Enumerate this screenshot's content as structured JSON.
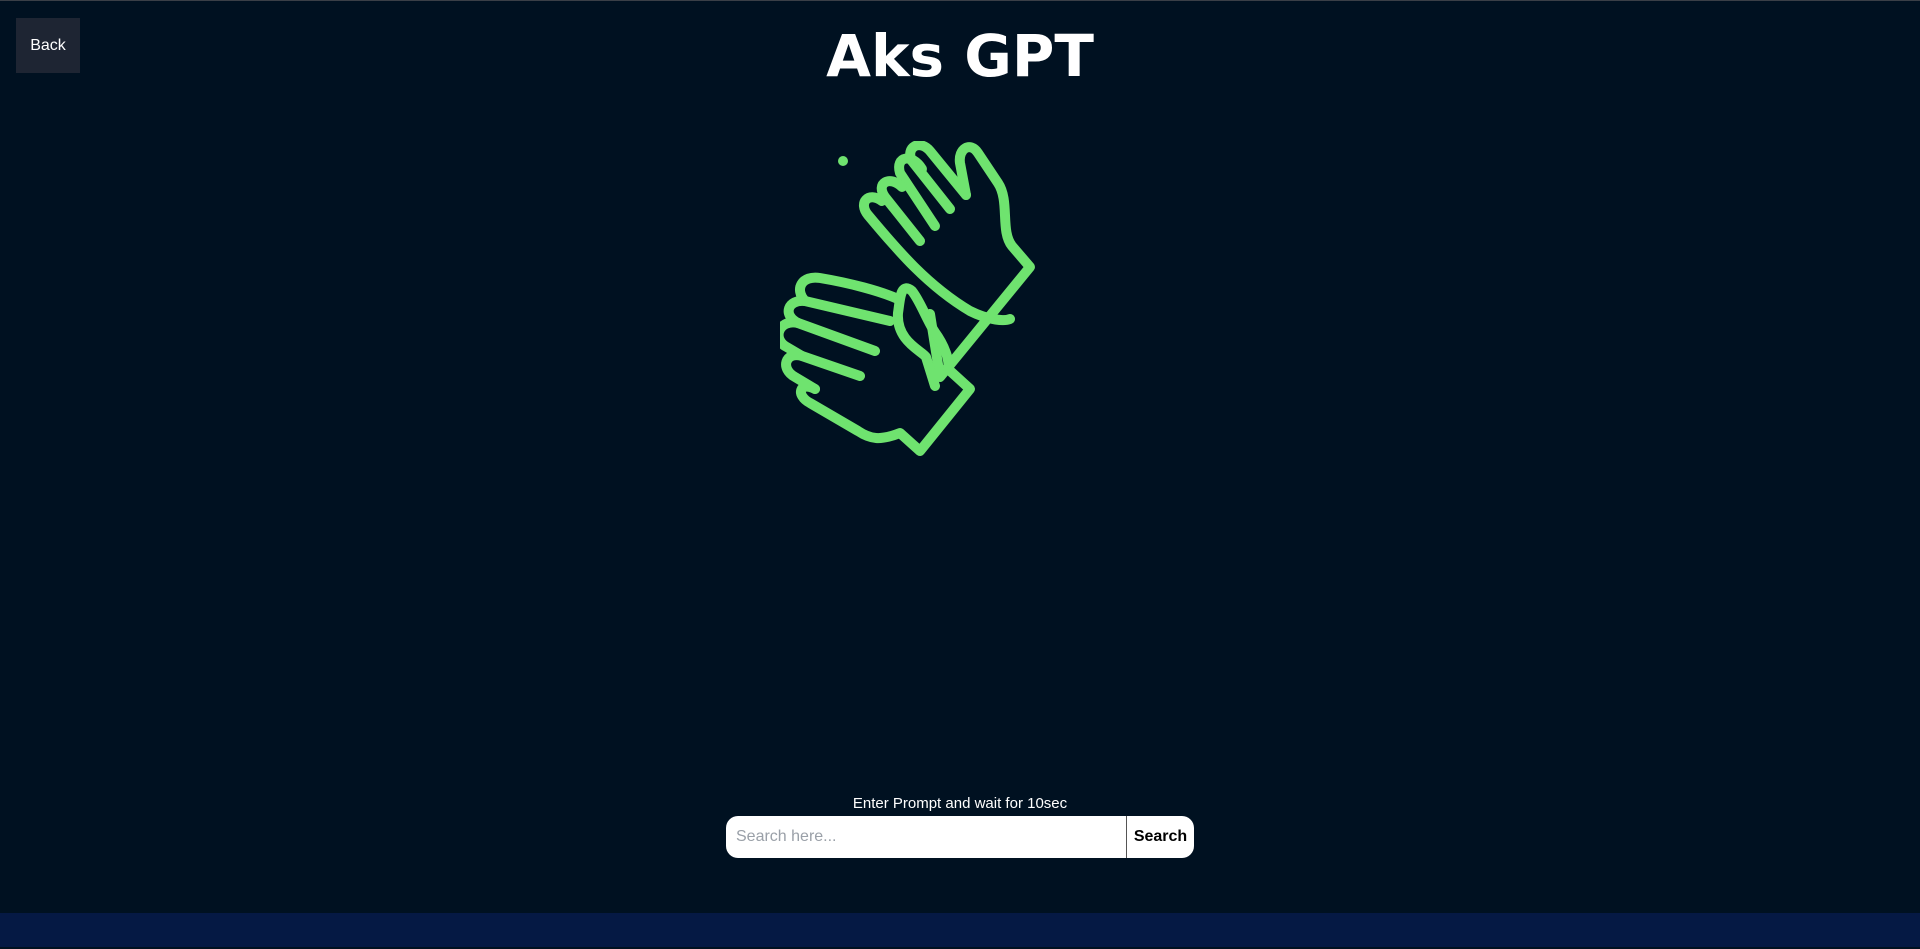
{
  "header": {
    "back_label": "Back",
    "title": "Aks GPT"
  },
  "illustration": {
    "icon": "clapping-hands-icon",
    "color": "#6fe36f"
  },
  "search": {
    "hint": "Enter Prompt and wait for 10sec",
    "placeholder": "Search here...",
    "button_label": "Search"
  },
  "colors": {
    "background": "#001121",
    "footer": "#051944",
    "accent": "#6fe36f"
  }
}
